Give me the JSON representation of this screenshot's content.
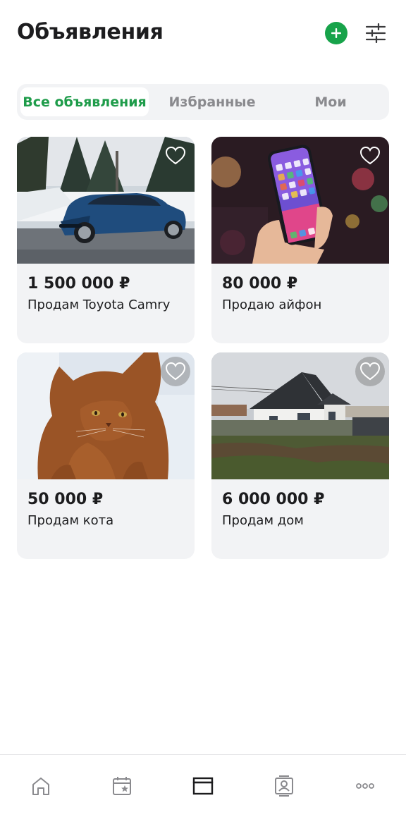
{
  "header": {
    "title": "Объявления",
    "add_icon": "plus-circle-icon",
    "filter_icon": "sliders-icon"
  },
  "tabs": [
    {
      "label": "Все объявления",
      "active": true
    },
    {
      "label": "Избранные",
      "active": false
    },
    {
      "label": "Мои",
      "active": false
    }
  ],
  "listings": [
    {
      "price": "1 500 000 ₽",
      "title": "Продам Toyota Camry",
      "image": "blue-sedan-in-snow",
      "favorite_icon": "heart-outline-icon"
    },
    {
      "price": "80 000 ₽",
      "title": "Продаю айфон",
      "image": "smartphone-in-hand",
      "favorite_icon": "heart-outline-icon"
    },
    {
      "price": "50 000 ₽",
      "title": "Продам кота",
      "image": "british-cat",
      "favorite_icon": "heart-outline-icon"
    },
    {
      "price": "6 000 000 ₽",
      "title": "Продам дом",
      "image": "white-house",
      "favorite_icon": "heart-outline-icon"
    }
  ],
  "bottom_nav": [
    {
      "icon": "home-icon",
      "active": false
    },
    {
      "icon": "calendar-star-icon",
      "active": false
    },
    {
      "icon": "listings-icon",
      "active": true
    },
    {
      "icon": "contact-card-icon",
      "active": false
    },
    {
      "icon": "more-dots-icon",
      "active": false
    }
  ],
  "colors": {
    "accent": "#17a34a",
    "active_tab_text": "#1e9c4a",
    "card_bg": "#f2f3f5",
    "inactive_text": "#8a8a8e"
  }
}
